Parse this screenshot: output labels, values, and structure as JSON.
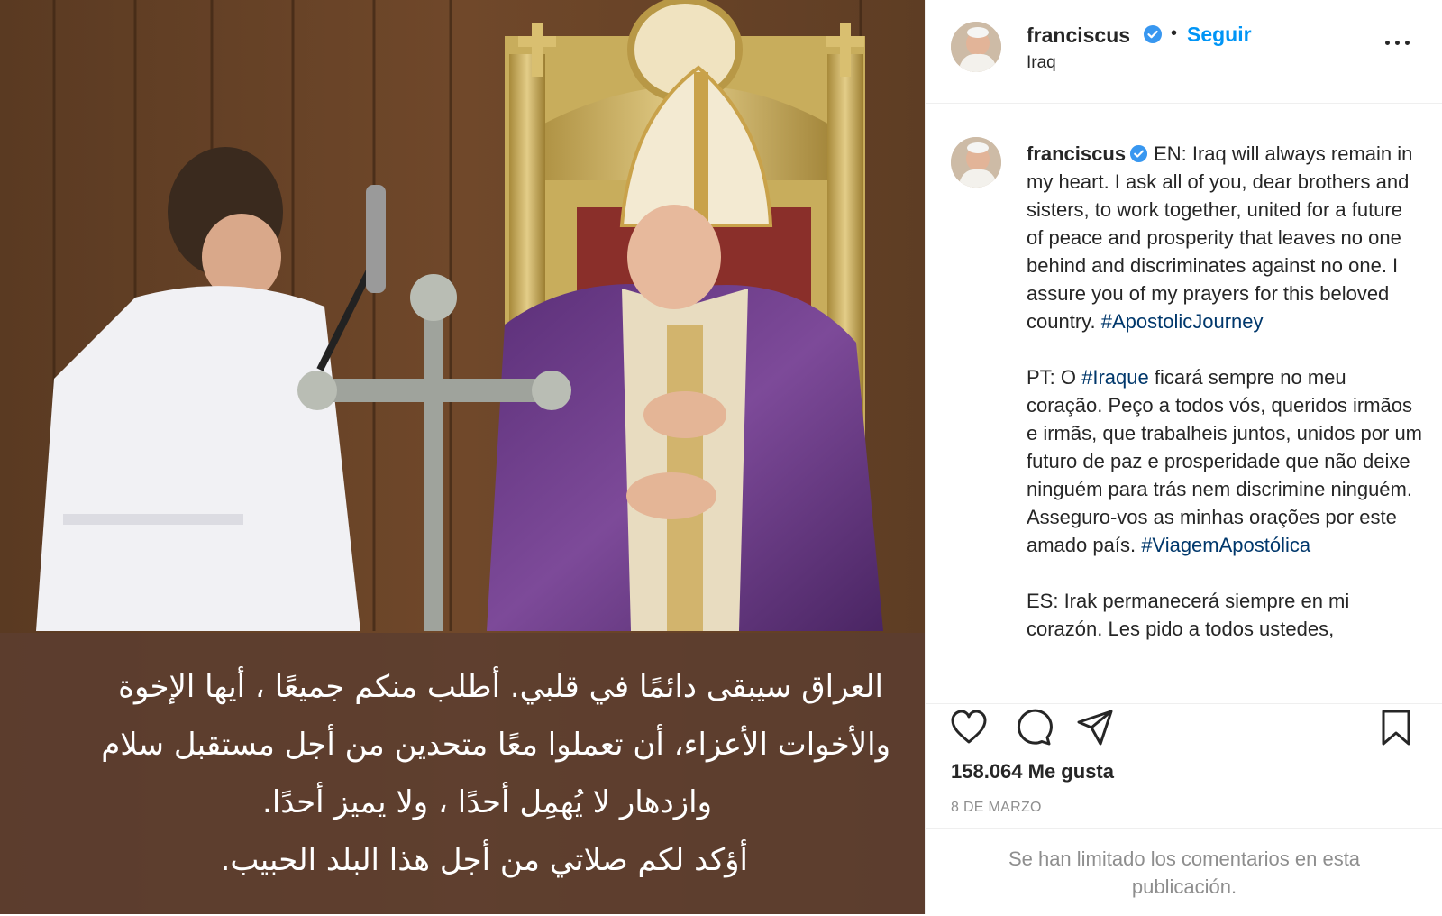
{
  "media": {
    "caption_lines": [
      "العراق سيبقى دائمًا في قلبي. أطلب منكم جميعًا ، أيها الإخوة",
      "والأخوات الأعزاء، أن تعملوا معًا متحدين من أجل مستقبل سلام",
      "وازدهار لا يُهمِل أحدًا ، ولا يميز أحدًا.",
      "أؤكد لكم صلاتي من أجل هذا البلد الحبيب."
    ]
  },
  "header": {
    "username": "franciscus",
    "separator": "•",
    "follow_label": "Seguir",
    "location": "Iraq"
  },
  "caption": {
    "username": "franciscus",
    "en_text": "EN: Iraq will always remain in my heart. I ask all of you, dear brothers and sisters, to work together, united for a future of peace and prosperity that leaves no one behind and discriminates against no one. I assure you of my prayers for this beloved country. ",
    "en_hashtag": "#ApostolicJourney",
    "pt_prefix": "PT: O ",
    "pt_hashtag_1": "#Iraque",
    "pt_text": " ficará sempre no meu coração. Peço a todos vós, queridos irmãos e irmãs, que trabalheis juntos, unidos por um futuro de paz e prosperidade que não deixe ninguém para trás nem discrimine ninguém. Asseguro-vos as minhas orações por este amado país. ",
    "pt_hashtag_2": "#ViagemApostólica",
    "es_text": "ES: Irak permanecerá siempre en mi corazón. Les pido a todos ustedes,"
  },
  "actions": {
    "likes": "158.064 Me gusta",
    "date": "8 DE MARZO",
    "comments_limited": "Se han limitado los comentarios en esta publicación."
  },
  "icons": {
    "like": "heart-icon",
    "comment": "comment-icon",
    "share": "share-icon",
    "save": "bookmark-icon",
    "verified": "verified-badge-icon",
    "more": "more-options-icon"
  },
  "colors": {
    "link_blue": "#0095f6",
    "hashtag": "#00376b",
    "secondary_text": "#8e8e8e",
    "verified": "#3897f0"
  }
}
